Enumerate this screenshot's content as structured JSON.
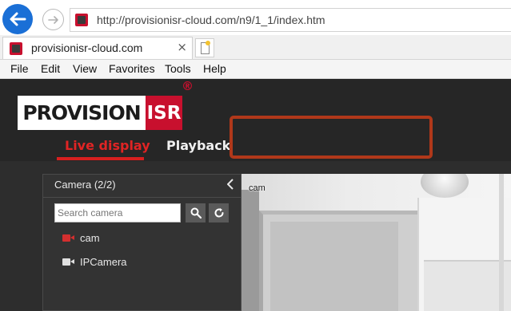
{
  "browser": {
    "url": "http://provisionisr-cloud.com/n9/1_1/index.htm",
    "tab_title": "provisionisr-cloud.com",
    "tab_close": "×",
    "menu": [
      "File",
      "Edit",
      "View",
      "Favorites",
      "Tools",
      "Help"
    ]
  },
  "app": {
    "logo_left": "PROVISION",
    "logo_right": "ISR",
    "logo_registered": "®",
    "nav": {
      "live": "Live display",
      "playback": "Playback"
    }
  },
  "camera_panel": {
    "title": "Camera (2/2)",
    "search_placeholder": "Search camera",
    "cameras": [
      {
        "label": "cam",
        "icon": "camera-icon",
        "color": "#d32f2f"
      },
      {
        "label": "IPCamera",
        "icon": "camera-icon",
        "color": "#e0e0e0"
      }
    ]
  },
  "video": {
    "label": "cam"
  },
  "colors": {
    "accent": "#d81f1f",
    "header_bg": "#262626",
    "highlight_border": "#b0381a",
    "browser_back": "#1a6fd6"
  }
}
